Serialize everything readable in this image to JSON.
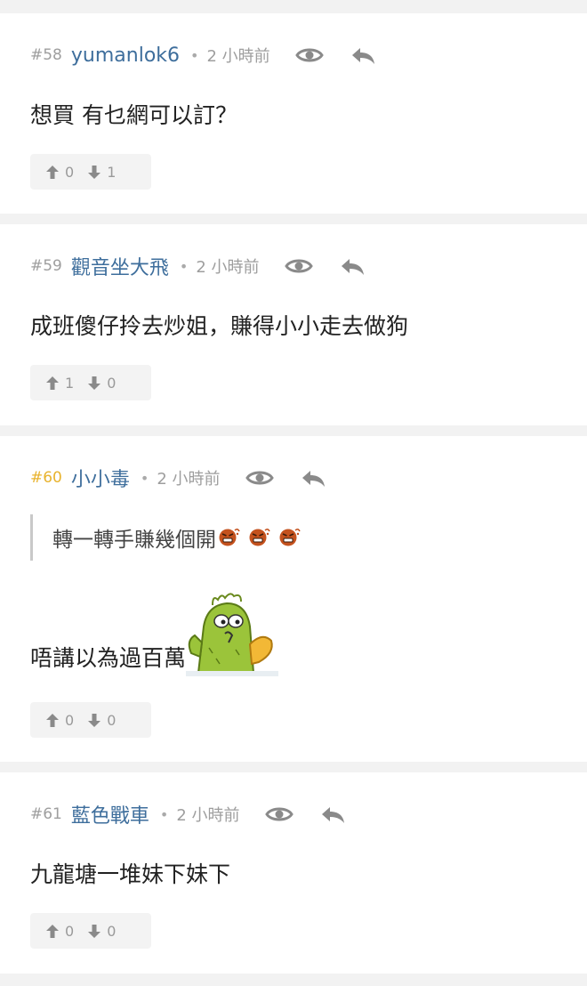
{
  "colors": {
    "background": "#f2f2f2",
    "card": "#ffffff",
    "username": "#3e6e9c",
    "meta_text": "#9e9e9e",
    "highlight_number": "#e8b32e",
    "body_text": "#222222",
    "vote_box": "#f3f3f3",
    "icon": "#8a8a8a"
  },
  "posts": [
    {
      "number": "#58",
      "username": "yumanlok6",
      "separator": "•",
      "time": "2 小時前",
      "body": "想買 有乜網可以訂？",
      "upvotes": "0",
      "downvotes": "1"
    },
    {
      "number": "#59",
      "username": "觀音坐大飛",
      "separator": "•",
      "time": "2 小時前",
      "body": "成班傻仔拎去炒姐，賺得小小走去做狗",
      "upvotes": "1",
      "downvotes": "0"
    },
    {
      "number": "#60",
      "username": "小小毒",
      "separator": "•",
      "time": "2 小時前",
      "quote": "轉一轉手賺幾個開",
      "body": "唔講以為過百萬",
      "sticker": "green-cactus-sticker",
      "emoji": "angry-face-emoji",
      "upvotes": "0",
      "downvotes": "0"
    },
    {
      "number": "#61",
      "username": "藍色戰車",
      "separator": "•",
      "time": "2 小時前",
      "body": "九龍塘一堆妹下妹下",
      "upvotes": "0",
      "downvotes": "0"
    }
  ],
  "icons": {
    "view": "eye-icon",
    "reply": "reply-icon",
    "upvote": "arrow-up-icon",
    "downvote": "arrow-down-icon"
  }
}
